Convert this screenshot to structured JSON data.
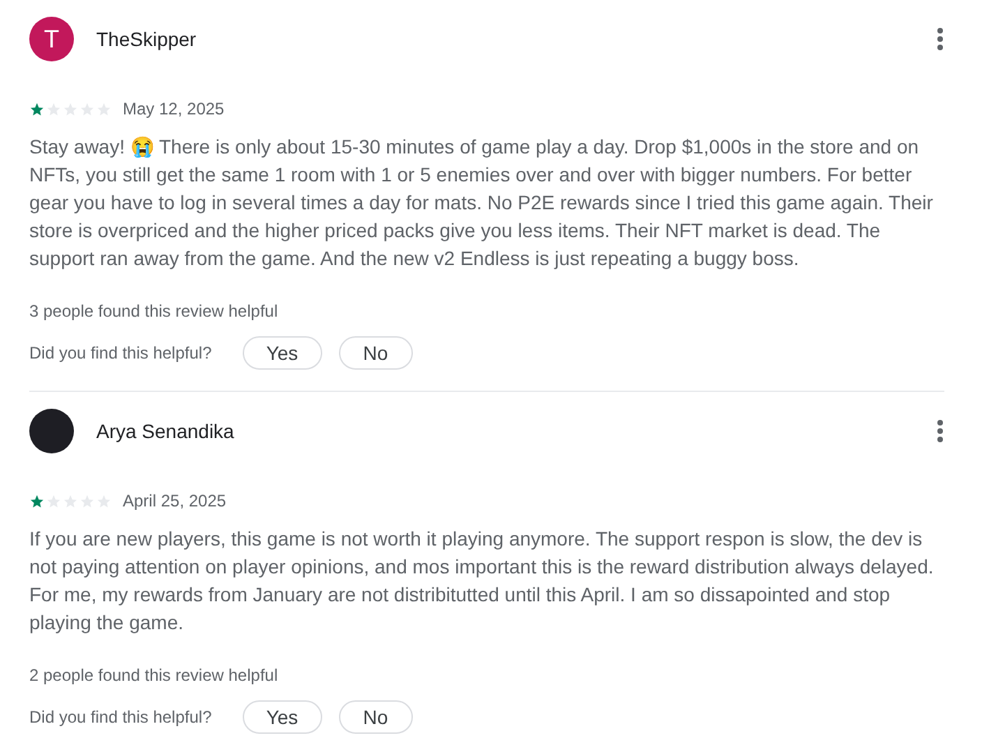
{
  "reviews": [
    {
      "author": "TheSkipper",
      "kind": "letter",
      "avatar_letter": "T",
      "stars": 1,
      "date": "May 12, 2025",
      "text": "Stay away! 😭 There is only about 15-30 minutes of game play a day. Drop $1,000s in the store and on NFTs, you still get the same 1 room with 1 or 5 enemies over and over with bigger numbers. For better gear you have to log in several times a day for mats. No P2E rewards since I tried this game again. Their store is overpriced and the higher priced packs give you less items. Their NFT market is dead. The support ran away from the game. And the new v2 Endless is just repeating a buggy boss.",
      "helpful_count": "3 people found this review helpful",
      "helpful_question": "Did you find this helpful?",
      "buttons": [
        "Yes",
        "No"
      ]
    },
    {
      "author": "Arya Senandika",
      "kind": "image",
      "stars": 1,
      "date": "April 25, 2025",
      "text": "If you are new players, this game is not worth it playing anymore. The support respon is slow, the dev is not paying attention on player opinions, and mos important this is the reward distribution always delayed. For me, my rewards from January are not distribitutted until this April. I am so dissapointed and stop playing the game.",
      "helpful_count": "2 people found this review helpful",
      "helpful_question": "Did you find this helpful?",
      "buttons": [
        "Yes",
        "No"
      ]
    }
  ]
}
